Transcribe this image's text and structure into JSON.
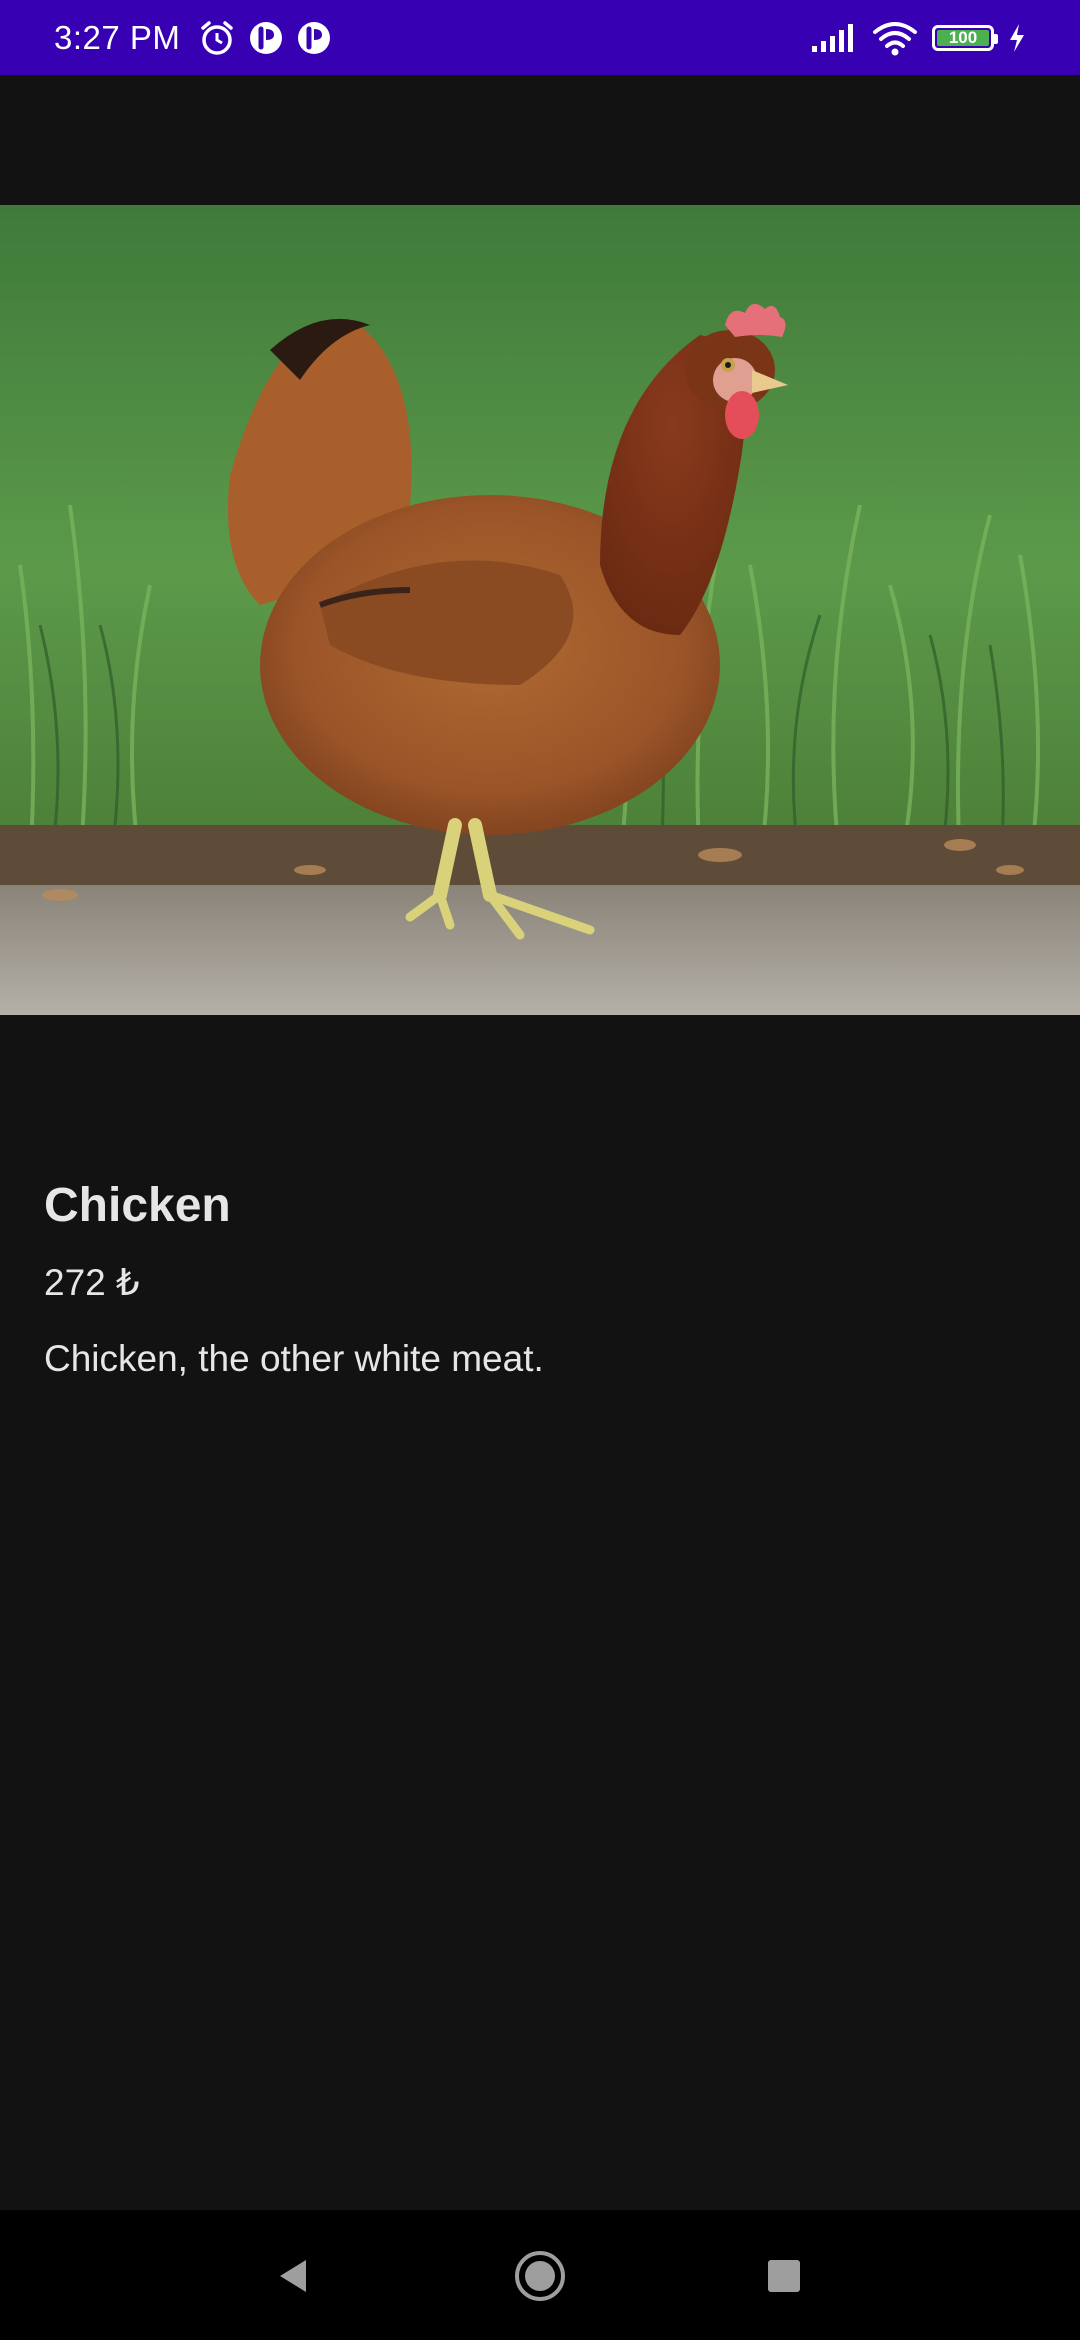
{
  "status_bar": {
    "time": "3:27 PM",
    "battery_level": "100",
    "battery_fraction": 1.0,
    "icons": [
      "alarm-icon",
      "app-notification-icon",
      "app-notification-icon",
      "signal-icon",
      "wifi-icon",
      "battery-icon",
      "charging-icon"
    ],
    "background_color": "#3700b3"
  },
  "product": {
    "image_alt": "Chicken",
    "name": "Chicken",
    "price": "272 ₺",
    "description": "Chicken, the other white meat."
  },
  "nav_bar": {
    "icons": [
      "back-icon",
      "home-icon",
      "recents-icon"
    ]
  }
}
